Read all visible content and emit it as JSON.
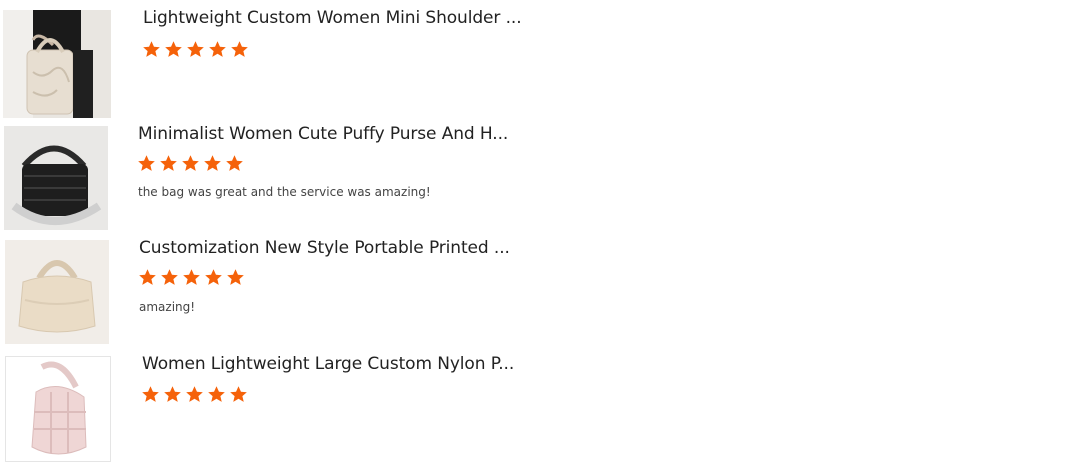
{
  "star_color": "#f5620a",
  "reviews": [
    {
      "title": "Lightweight Custom Women Mini Shoulder ...",
      "rating": 5,
      "comment": "",
      "image_icon": "cream-quilted-mini-tote-photo"
    },
    {
      "title": "Minimalist Women Cute Puffy Purse And H...",
      "rating": 5,
      "comment": "the bag was great and the service was amazing!",
      "image_icon": "black-puffy-tote-photo"
    },
    {
      "title": "Customization New Style Portable Printed ...",
      "rating": 5,
      "comment": "amazing!",
      "image_icon": "beige-puffer-tote-photo"
    },
    {
      "title": "Women Lightweight Large Custom Nylon P...",
      "rating": 5,
      "comment": "",
      "image_icon": "pink-quilted-shoulder-bag-photo"
    }
  ]
}
